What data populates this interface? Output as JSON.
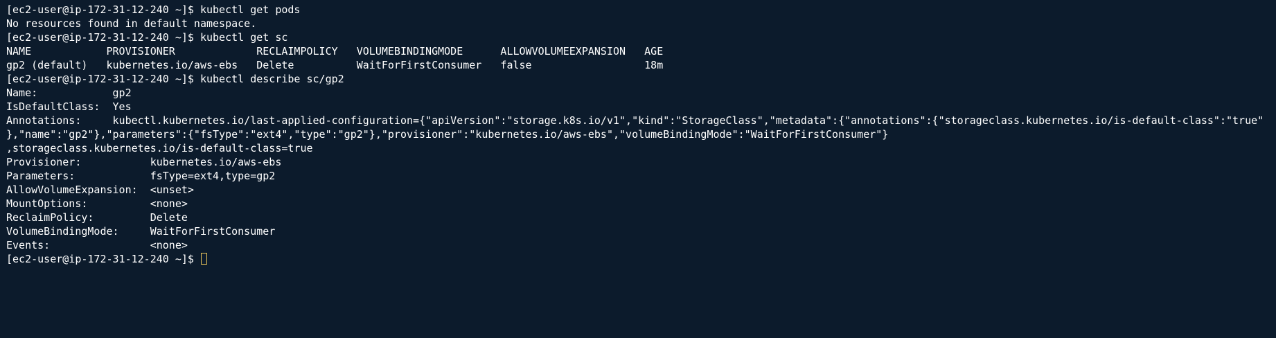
{
  "terminal": {
    "lines": [
      "[ec2-user@ip-172-31-12-240 ~]$ kubectl get pods",
      "No resources found in default namespace.",
      "[ec2-user@ip-172-31-12-240 ~]$ kubectl get sc",
      "NAME            PROVISIONER             RECLAIMPOLICY   VOLUMEBINDINGMODE      ALLOWVOLUMEEXPANSION   AGE",
      "gp2 (default)   kubernetes.io/aws-ebs   Delete          WaitForFirstConsumer   false                  18m",
      "[ec2-user@ip-172-31-12-240 ~]$ kubectl describe sc/gp2",
      "Name:            gp2",
      "IsDefaultClass:  Yes",
      "Annotations:     kubectl.kubernetes.io/last-applied-configuration={\"apiVersion\":\"storage.k8s.io/v1\",\"kind\":\"StorageClass\",\"metadata\":{\"annotations\":{\"storageclass.kubernetes.io/is-default-class\":\"true\"",
      "},\"name\":\"gp2\"},\"parameters\":{\"fsType\":\"ext4\",\"type\":\"gp2\"},\"provisioner\":\"kubernetes.io/aws-ebs\",\"volumeBindingMode\":\"WaitForFirstConsumer\"}",
      ",storageclass.kubernetes.io/is-default-class=true",
      "Provisioner:           kubernetes.io/aws-ebs",
      "Parameters:            fsType=ext4,type=gp2",
      "AllowVolumeExpansion:  <unset>",
      "MountOptions:          <none>",
      "ReclaimPolicy:         Delete",
      "VolumeBindingMode:     WaitForFirstConsumer",
      "Events:                <none>"
    ],
    "prompt": "[ec2-user@ip-172-31-12-240 ~]$ ",
    "colors": {
      "background": "#0c1b2c",
      "foreground": "#ffffff",
      "cursor": "#e8c35a"
    }
  }
}
